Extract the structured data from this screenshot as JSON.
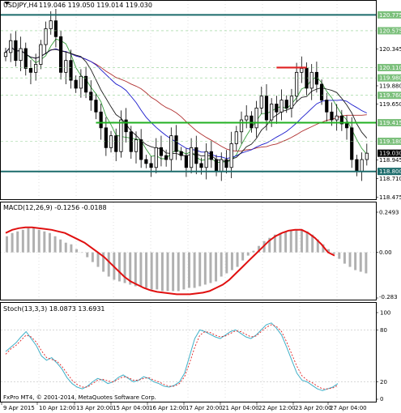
{
  "window": {
    "symbol_title": "USDJPY,H4",
    "ohlc_text": "119.046 119.050 119.014 119.030",
    "copyright": "FxPro MT4, © 2001-2014, MetaQuotes Software Corp."
  },
  "colors": {
    "background": "#ffffff",
    "grid": "#c0c0c0",
    "candle": "#000000",
    "ma_fast": "#1e1e1e",
    "ma_slow": "#1a1acc",
    "ma_long": "#b03030",
    "ma_green": "#3aa040",
    "support_green": "#22b022",
    "resistance_red": "#e02020",
    "teal_line": "#1b6b6b",
    "level_label_bg": "#7cc07c",
    "price_label_bg": "#000000",
    "macd_hist": "#b0b0b0",
    "macd_signal": "#e01010",
    "stoch_main": "#40b0c8",
    "stoch_signal": "#e02020"
  },
  "price_axis": {
    "ticks": [
      "120.775",
      "120.575",
      "120.345",
      "120.110",
      "119.880",
      "119.650",
      "119.415",
      "119.180",
      "118.945",
      "118.710",
      "118.475"
    ],
    "current_price": "119.030"
  },
  "levels": {
    "teal_top": "120.775",
    "teal_bottom": "118.800",
    "green_support": "119.415",
    "red_resistance": "120.110",
    "mid_labels": [
      "120.575",
      "120.110",
      "119.980",
      "119.760",
      "119.180"
    ]
  },
  "macd_panel": {
    "title": "MACD(12,26,9) -0.1256 -0.0188",
    "ticks": [
      "0.2493",
      "0.00",
      "-0.283"
    ]
  },
  "stoch_panel": {
    "title": "Stoch(13,3,3) 18.0873 13.6931",
    "ticks": [
      "100",
      "80",
      "20",
      "0"
    ]
  },
  "time_axis": [
    "9 Apr 2015",
    "10 Apr 12:00",
    "13 Apr 20:00",
    "15 Apr 04:00",
    "16 Apr 12:00",
    "17 Apr 20:00",
    "21 Apr 04:00",
    "22 Apr 12:00",
    "23 Apr 20:00",
    "27 Apr 04:00"
  ],
  "chart_data": [
    {
      "type": "candlestick",
      "title": "USDJPY,H4",
      "ylim": [
        118.47,
        120.84
      ],
      "closes": [
        120.3,
        120.45,
        120.2,
        120.35,
        120.1,
        120.05,
        120.15,
        120.4,
        120.6,
        120.7,
        120.5,
        120.05,
        120.2,
        119.95,
        119.85,
        120.0,
        119.8,
        119.7,
        119.55,
        119.35,
        119.1,
        119.25,
        119.05,
        119.45,
        119.3,
        119.05,
        119.2,
        118.95,
        118.9,
        118.85,
        119.1,
        119.0,
        118.95,
        119.25,
        119.05,
        119.0,
        118.85,
        119.1,
        118.9,
        118.85,
        119.05,
        118.95,
        118.8,
        118.95,
        118.85,
        119.15,
        119.3,
        119.45,
        119.5,
        119.35,
        119.6,
        119.75,
        119.45,
        119.65,
        119.55,
        119.7,
        119.6,
        119.75,
        120.05,
        120.1,
        119.85,
        120.05,
        119.9,
        119.7,
        119.55,
        119.45,
        119.5,
        119.4,
        119.35,
        118.95,
        118.8,
        118.95,
        119.03
      ],
      "horizontal_levels": [
        120.775,
        119.415,
        118.8
      ],
      "resistance_segment": 120.11
    },
    {
      "type": "macd",
      "title": "MACD(12,26,9)",
      "ylim": [
        -0.283,
        0.2493
      ],
      "histogram": [
        0.1,
        0.12,
        0.13,
        0.14,
        0.15,
        0.15,
        0.14,
        0.13,
        0.12,
        0.1,
        0.08,
        0.06,
        0.05,
        0.02,
        0.0,
        -0.03,
        -0.06,
        -0.09,
        -0.12,
        -0.15,
        -0.17,
        -0.18,
        -0.19,
        -0.2,
        -0.21,
        -0.21,
        -0.22,
        -0.23,
        -0.23,
        -0.24,
        -0.24,
        -0.24,
        -0.24,
        -0.23,
        -0.22,
        -0.22,
        -0.21,
        -0.2,
        -0.19,
        -0.18,
        -0.15,
        -0.13,
        -0.11,
        -0.09,
        -0.05,
        -0.02,
        0.01,
        0.04,
        0.07,
        0.09,
        0.11,
        0.12,
        0.13,
        0.14,
        0.14,
        0.14,
        0.13,
        0.11,
        0.08,
        0.05,
        0.02,
        -0.01,
        -0.04,
        -0.07,
        -0.09,
        -0.11,
        -0.12,
        -0.13
      ],
      "signal": [
        0.12,
        0.14,
        0.15,
        0.155,
        0.155,
        0.15,
        0.145,
        0.14,
        0.13,
        0.12,
        0.1,
        0.08,
        0.06,
        0.03,
        0.0,
        -0.03,
        -0.07,
        -0.11,
        -0.15,
        -0.18,
        -0.2,
        -0.22,
        -0.235,
        -0.245,
        -0.25,
        -0.255,
        -0.26,
        -0.26,
        -0.26,
        -0.255,
        -0.25,
        -0.24,
        -0.22,
        -0.2,
        -0.17,
        -0.13,
        -0.09,
        -0.05,
        -0.01,
        0.03,
        0.07,
        0.1,
        0.12,
        0.135,
        0.14,
        0.14,
        0.12,
        0.09,
        0.05,
        0.0,
        -0.02
      ]
    },
    {
      "type": "stochastic",
      "title": "Stoch(13,3,3)",
      "ylim": [
        0,
        100
      ],
      "main": [
        55,
        60,
        65,
        72,
        78,
        70,
        62,
        50,
        45,
        48,
        42,
        35,
        25,
        18,
        14,
        12,
        15,
        20,
        24,
        22,
        18,
        20,
        25,
        28,
        24,
        20,
        22,
        26,
        24,
        20,
        18,
        15,
        14,
        16,
        20,
        30,
        50,
        70,
        80,
        78,
        75,
        72,
        70,
        74,
        78,
        80,
        76,
        72,
        70,
        74,
        80,
        86,
        88,
        82,
        74,
        60,
        45,
        30,
        22,
        20,
        16,
        12,
        10,
        12,
        14,
        18
      ],
      "signal": [
        52,
        58,
        62,
        68,
        74,
        72,
        66,
        56,
        48,
        46,
        44,
        38,
        30,
        22,
        17,
        14,
        14,
        18,
        22,
        23,
        21,
        20,
        23,
        26,
        25,
        22,
        22,
        24,
        25,
        22,
        20,
        17,
        15,
        15,
        18,
        26,
        42,
        60,
        74,
        78,
        77,
        74,
        72,
        73,
        76,
        79,
        78,
        75,
        72,
        73,
        78,
        83,
        86,
        84,
        78,
        66,
        52,
        38,
        27,
        22,
        19,
        15,
        12,
        12,
        13,
        16
      ],
      "reference_levels": [
        20,
        80
      ]
    }
  ]
}
